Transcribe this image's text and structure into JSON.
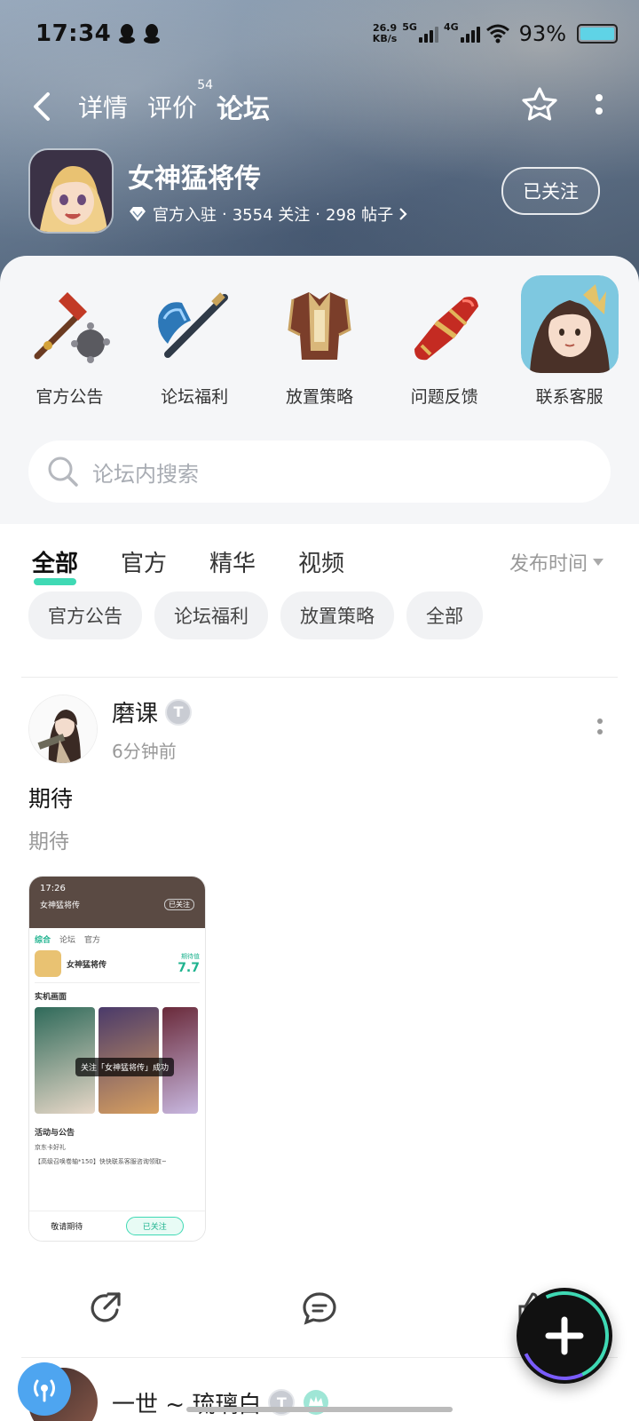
{
  "status_bar": {
    "time": "17:34",
    "speed_value": "26.9",
    "speed_unit": "KB/s",
    "net_5g": "5G",
    "net_4g": "4G",
    "battery_percent": "93%"
  },
  "nav": {
    "tabs": [
      {
        "label": "详情"
      },
      {
        "label": "评价",
        "badge": "54"
      },
      {
        "label": "论坛"
      }
    ],
    "active_tab": "论坛"
  },
  "game": {
    "title": "女神猛将传",
    "verified_label": "官方入驻",
    "followers": "3554 关注",
    "posts": "298 帖子",
    "follow_button": "已关注"
  },
  "categories": [
    {
      "label": "官方公告",
      "icon": "hammer-icon"
    },
    {
      "label": "论坛福利",
      "icon": "blue-axe-icon"
    },
    {
      "label": "放置策略",
      "icon": "armor-icon"
    },
    {
      "label": "问题反馈",
      "icon": "gauntlet-icon"
    },
    {
      "label": "联系客服",
      "icon": "character-avatar"
    }
  ],
  "search": {
    "placeholder": "论坛内搜索"
  },
  "filter_tabs": [
    {
      "label": "全部"
    },
    {
      "label": "官方"
    },
    {
      "label": "精华"
    },
    {
      "label": "视频"
    }
  ],
  "sort_label": "发布时间",
  "chips": [
    {
      "label": "官方公告"
    },
    {
      "label": "论坛福利"
    },
    {
      "label": "放置策略"
    },
    {
      "label": "全部"
    }
  ],
  "post": {
    "author": "磨课",
    "level_badge": "T",
    "time": "6分钟前",
    "title": "期待",
    "body": "期待",
    "screenshot": {
      "time": "17:26",
      "app_name": "女神猛将传",
      "follow_label": "已关注",
      "tabs": [
        "综合",
        "论坛",
        "官方"
      ],
      "game_name": "女神猛将传",
      "rating_label": "期待值",
      "rating": "7.7",
      "section_real": "实机画面",
      "toast": "关注「女神猛将传」成功",
      "section_events": "活动与公告",
      "event1": "京东卡好礼",
      "event2": "【高级召唤卷轴*150】快快联系客服咨询领取~",
      "bottom_left": "敬请期待",
      "bottom_right": "已关注"
    }
  },
  "next_post": {
    "author": "一世 ~ 琉璃白",
    "level_badge": "T"
  },
  "colors": {
    "accent": "#3fd9b4",
    "text_primary": "#222222",
    "text_secondary": "#999999"
  }
}
